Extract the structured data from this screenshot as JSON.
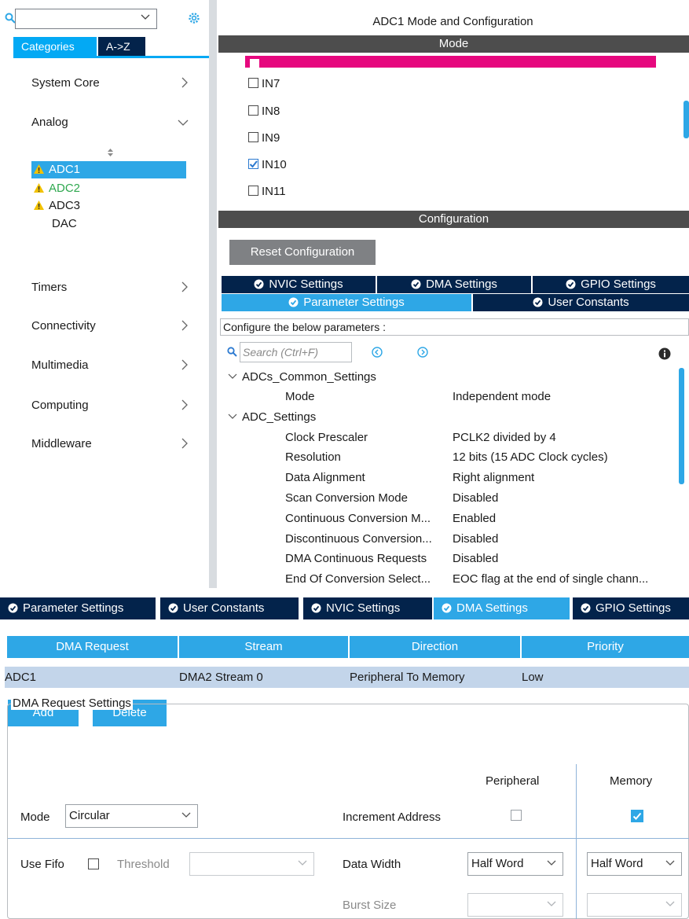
{
  "sidebar": {
    "search_value": "",
    "tabs": [
      "Categories",
      "A->Z"
    ],
    "categories": [
      {
        "label": "System Core"
      },
      {
        "label": "Analog"
      },
      {
        "label": "Timers"
      },
      {
        "label": "Connectivity"
      },
      {
        "label": "Multimedia"
      },
      {
        "label": "Computing"
      },
      {
        "label": "Middleware"
      }
    ],
    "analog_items": [
      "ADC1",
      "ADC2",
      "ADC3",
      "DAC"
    ]
  },
  "config": {
    "title": "ADC1 Mode and Configuration",
    "mode_bar": "Mode",
    "channels": [
      {
        "label": "IN7",
        "checked": false
      },
      {
        "label": "IN8",
        "checked": false
      },
      {
        "label": "IN9",
        "checked": false
      },
      {
        "label": "IN10",
        "checked": true
      },
      {
        "label": "IN11",
        "checked": false
      }
    ],
    "configuration_bar": "Configuration",
    "reset_button": "Reset Configuration",
    "tabs_row1": [
      "NVIC Settings",
      "DMA Settings",
      "GPIO Settings"
    ],
    "tabs_row2": [
      "Parameter Settings",
      "User Constants"
    ],
    "param_header": "Configure the below parameters :",
    "search_placeholder": "Search (Ctrl+F)",
    "groups": [
      {
        "name": "ADCs_Common_Settings",
        "params": [
          {
            "name": "Mode",
            "value": "Independent mode"
          }
        ]
      },
      {
        "name": "ADC_Settings",
        "params": [
          {
            "name": "Clock Prescaler",
            "value": "PCLK2 divided by 4"
          },
          {
            "name": "Resolution",
            "value": "12 bits (15 ADC Clock cycles)"
          },
          {
            "name": "Data Alignment",
            "value": "Right alignment"
          },
          {
            "name": "Scan Conversion Mode",
            "value": "Disabled"
          },
          {
            "name": "Continuous Conversion M...",
            "value": "Enabled"
          },
          {
            "name": "Discontinuous Conversion...",
            "value": "Disabled"
          },
          {
            "name": "DMA Continuous Requests",
            "value": "Disabled"
          },
          {
            "name": "End Of Conversion Select...",
            "value": "EOC flag at the end of single chann..."
          }
        ]
      }
    ]
  },
  "dma": {
    "tabs": [
      "Parameter Settings",
      "User Constants",
      "NVIC Settings",
      "DMA Settings",
      "GPIO Settings"
    ],
    "active_tab": "DMA Settings",
    "columns": [
      "DMA Request",
      "Stream",
      "Direction",
      "Priority"
    ],
    "rows": [
      {
        "request": "ADC1",
        "stream": "DMA2 Stream 0",
        "direction": "Peripheral To Memory",
        "priority": "Low"
      }
    ],
    "add_button": "Add",
    "delete_button": "Delete",
    "settings": {
      "legend": "DMA Request Settings",
      "peripheral_header": "Peripheral",
      "memory_header": "Memory",
      "mode_label": "Mode",
      "mode_value": "Circular",
      "increment_label": "Increment Address",
      "increment_peripheral": false,
      "increment_memory": true,
      "use_fifo_label": "Use Fifo",
      "use_fifo": false,
      "threshold_label": "Threshold",
      "threshold_value": "",
      "data_width_label": "Data Width",
      "data_width_peripheral": "Half Word",
      "data_width_memory": "Half Word",
      "burst_size_label": "Burst Size",
      "burst_peripheral": "",
      "burst_memory": ""
    }
  },
  "colors": {
    "accent": "#2ea7e6",
    "navy": "#03234b",
    "pink": "#e6087e",
    "warning": "#f2c200",
    "ok_green": "#2fa84f"
  }
}
